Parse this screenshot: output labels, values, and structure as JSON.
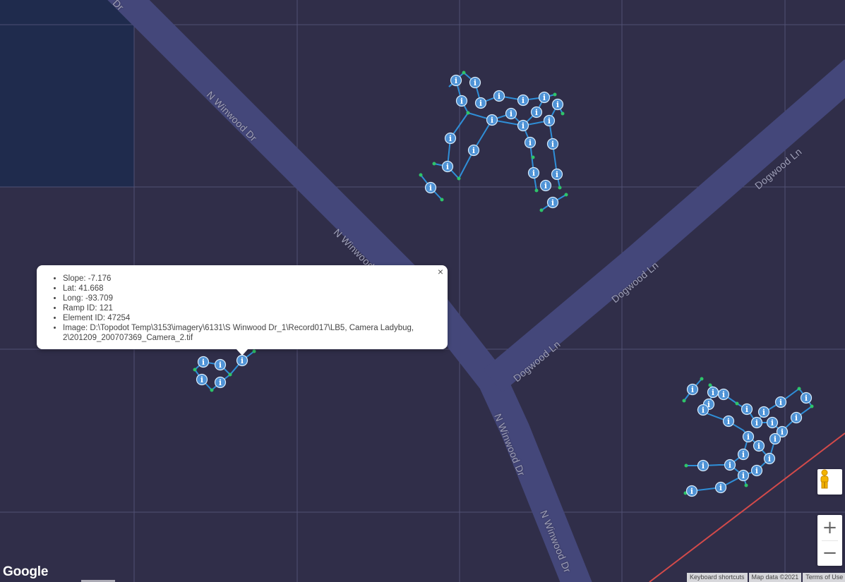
{
  "map": {
    "streets": [
      {
        "name": "N Winwood Dr",
        "id": "nw-top"
      },
      {
        "name": "N Winwood Dr",
        "id": "nw-mid"
      },
      {
        "name": "N Winwood Dr",
        "id": "nw-low1"
      },
      {
        "name": "N Winwood Dr",
        "id": "nw-low2"
      },
      {
        "name": "Dogwood Ln",
        "id": "dw-1"
      },
      {
        "name": "Dogwood Ln",
        "id": "dw-2"
      },
      {
        "name": "Dogwood Ln",
        "id": "dw-3"
      },
      {
        "name": "Dr",
        "id": "dr-top"
      }
    ],
    "colors": {
      "background": "#302e49",
      "road": "#44477a",
      "grid": "#57567c",
      "segment": "#2f8fd8",
      "marker": "#4f93d6",
      "endpoint": "#2ec46a",
      "boundary": "#d34a4a",
      "dark_block": "#1f2b4d"
    },
    "marker_icon": "info-marker-icon",
    "marker_glyph": "i"
  },
  "info_window": {
    "items": [
      "Slope: -7.176",
      "Lat: 41.668",
      "Long: -93.709",
      "Ramp ID: 121",
      "Element ID: 47254",
      "Image: D:\\Topodot Temp\\3153\\imagery\\6131\\S Winwood Dr_1\\Record017\\LB5, Camera Ladybug, 2\\201209_200707369_Camera_2.tif"
    ],
    "close_icon": "close-icon",
    "close_glyph": "×"
  },
  "controls": {
    "pegman_icon": "pegman-icon",
    "zoom_in": "+",
    "zoom_out": "−"
  },
  "footer": {
    "logo": "Google",
    "keyboard_shortcuts": "Keyboard shortcuts",
    "map_data": "Map data ©2021",
    "terms": "Terms of Use"
  }
}
